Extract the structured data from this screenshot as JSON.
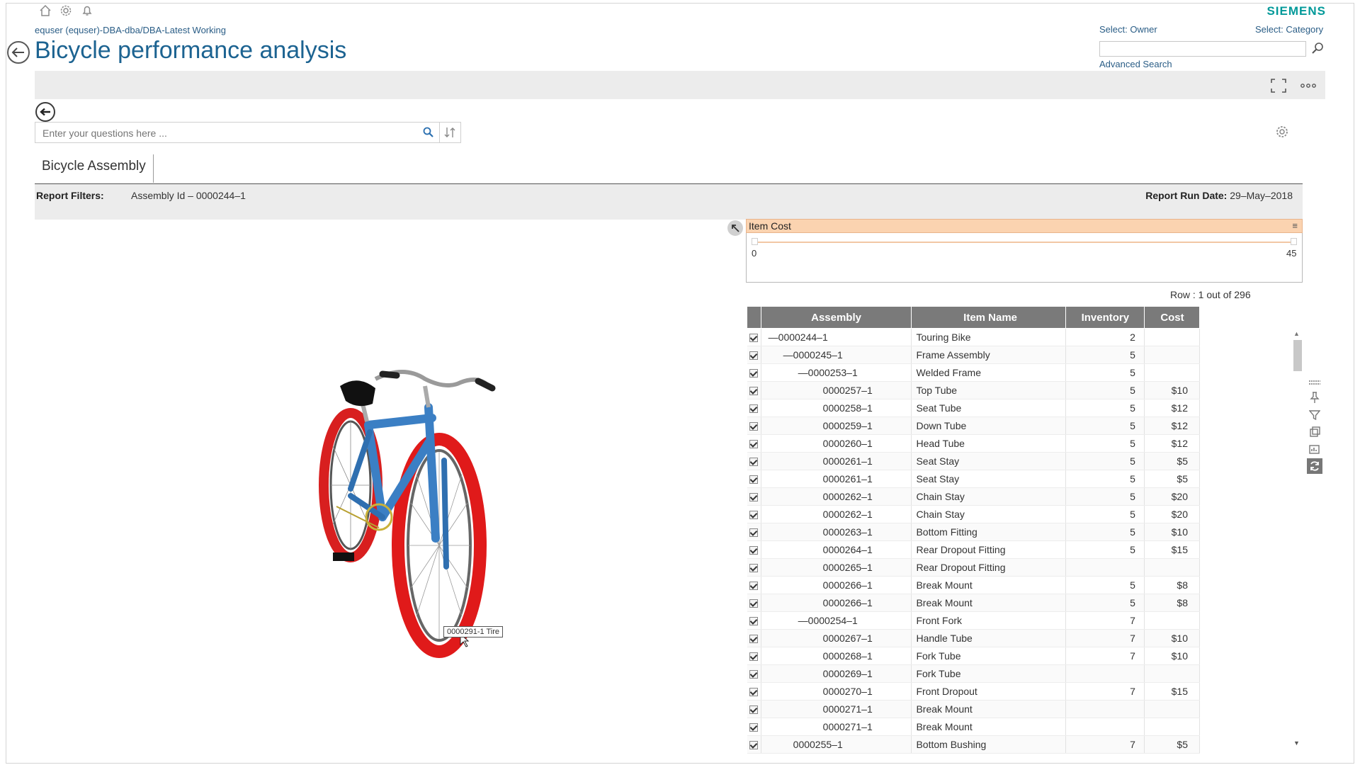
{
  "app": {
    "brand": "SIEMENS",
    "breadcrumb": "equser (equser)-DBA-dba/DBA-Latest Working",
    "title": "Bicycle performance analysis"
  },
  "top_search": {
    "owner_label": "Select: Owner",
    "category_label": "Select: Category",
    "value": "",
    "advanced_label": "Advanced Search"
  },
  "question": {
    "placeholder": "Enter your questions here ..."
  },
  "tab": {
    "label": "Bicycle Assembly"
  },
  "filters": {
    "label": "Report Filters:",
    "value": "Assembly Id  –  0000244–1",
    "run_date_label": "Report Run Date:",
    "run_date_value": " 29–May–2018"
  },
  "viewer": {
    "tooltip": "0000291-1 Tire"
  },
  "item_cost": {
    "title": "Item Cost",
    "menu": "≡",
    "min": "0",
    "max": "45"
  },
  "row_count": "Row : 1 out of 296",
  "table": {
    "headers": [
      "Assembly",
      "Item Name",
      "Inventory",
      "Cost"
    ],
    "rows": [
      {
        "asm": "0000244–1",
        "level": 0,
        "dash": true,
        "name": "Touring Bike",
        "inv": "2",
        "cost": ""
      },
      {
        "asm": "0000245–1",
        "level": 1,
        "dash": true,
        "name": "Frame Assembly",
        "inv": "5",
        "cost": ""
      },
      {
        "asm": "0000253–1",
        "level": 2,
        "dash": true,
        "name": "Welded Frame",
        "inv": "5",
        "cost": ""
      },
      {
        "asm": "0000257–1",
        "level": 3,
        "dash": false,
        "name": "Top Tube",
        "inv": "5",
        "cost": "$10"
      },
      {
        "asm": "0000258–1",
        "level": 3,
        "dash": false,
        "name": "Seat Tube",
        "inv": "5",
        "cost": "$12"
      },
      {
        "asm": "0000259–1",
        "level": 3,
        "dash": false,
        "name": "Down Tube",
        "inv": "5",
        "cost": "$12"
      },
      {
        "asm": "0000260–1",
        "level": 3,
        "dash": false,
        "name": "Head Tube",
        "inv": "5",
        "cost": "$12"
      },
      {
        "asm": "0000261–1",
        "level": 3,
        "dash": false,
        "name": "Seat Stay",
        "inv": "5",
        "cost": "$5"
      },
      {
        "asm": "0000261–1",
        "level": 3,
        "dash": false,
        "name": "Seat Stay",
        "inv": "5",
        "cost": "$5"
      },
      {
        "asm": "0000262–1",
        "level": 3,
        "dash": false,
        "name": "Chain Stay",
        "inv": "5",
        "cost": "$20"
      },
      {
        "asm": "0000262–1",
        "level": 3,
        "dash": false,
        "name": "Chain Stay",
        "inv": "5",
        "cost": "$20"
      },
      {
        "asm": "0000263–1",
        "level": 3,
        "dash": false,
        "name": "Bottom Fitting",
        "inv": "5",
        "cost": "$10"
      },
      {
        "asm": "0000264–1",
        "level": 3,
        "dash": false,
        "name": "Rear Dropout Fitting",
        "inv": "5",
        "cost": "$15"
      },
      {
        "asm": "0000265–1",
        "level": 3,
        "dash": false,
        "name": "Rear Dropout Fitting",
        "inv": "",
        "cost": ""
      },
      {
        "asm": "0000266–1",
        "level": 3,
        "dash": false,
        "name": "Break Mount",
        "inv": "5",
        "cost": "$8"
      },
      {
        "asm": "0000266–1",
        "level": 3,
        "dash": false,
        "name": "Break Mount",
        "inv": "5",
        "cost": "$8"
      },
      {
        "asm": "0000254–1",
        "level": 2,
        "dash": true,
        "name": "Front Fork",
        "inv": "7",
        "cost": ""
      },
      {
        "asm": "0000267–1",
        "level": 3,
        "dash": false,
        "name": "Handle Tube",
        "inv": "7",
        "cost": "$10"
      },
      {
        "asm": "0000268–1",
        "level": 3,
        "dash": false,
        "name": "Fork Tube",
        "inv": "7",
        "cost": "$10"
      },
      {
        "asm": "0000269–1",
        "level": 3,
        "dash": false,
        "name": "Fork Tube",
        "inv": "",
        "cost": ""
      },
      {
        "asm": "0000270–1",
        "level": 3,
        "dash": false,
        "name": "Front Dropout",
        "inv": "7",
        "cost": "$15"
      },
      {
        "asm": "0000271–1",
        "level": 3,
        "dash": false,
        "name": "Break Mount",
        "inv": "",
        "cost": ""
      },
      {
        "asm": "0000271–1",
        "level": 3,
        "dash": false,
        "name": "Break Mount",
        "inv": "",
        "cost": ""
      },
      {
        "asm": "0000255–1",
        "level": 1,
        "dash": false,
        "name": "Bottom Bushing",
        "inv": "7",
        "cost": "$5"
      }
    ]
  },
  "icons": {
    "home": "home-icon",
    "settings": "gear-icon",
    "notify": "bell-icon",
    "brand_color": "#009999",
    "title_color": "#1c6391",
    "cost_header_color": "#fbd3b0"
  }
}
